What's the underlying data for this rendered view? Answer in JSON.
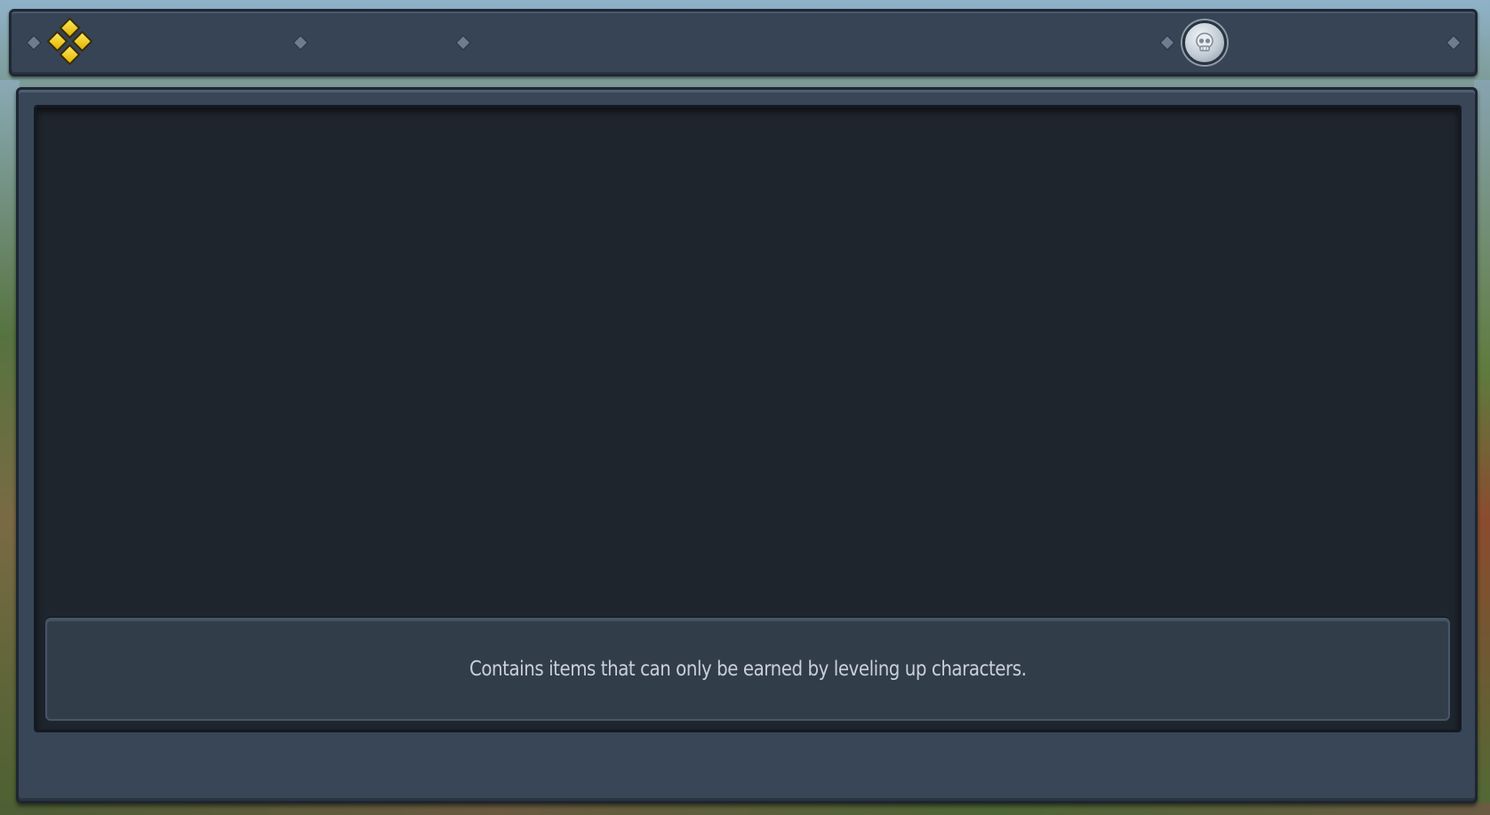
{
  "tabs": [
    {
      "id": "tab-items",
      "icon": "yellow-diamonds-icon",
      "selected": true
    },
    {
      "id": "tab-empty-1"
    },
    {
      "id": "tab-empty-2"
    },
    {
      "id": "tab-skull",
      "icon": "skull-coin-icon"
    }
  ],
  "panel": {
    "description": "Contains items that can only be earned by leveling up characters."
  },
  "colors": {
    "frame": "#364455",
    "content_bg": "#1f252d",
    "accent_gold": "#ffd91a"
  }
}
